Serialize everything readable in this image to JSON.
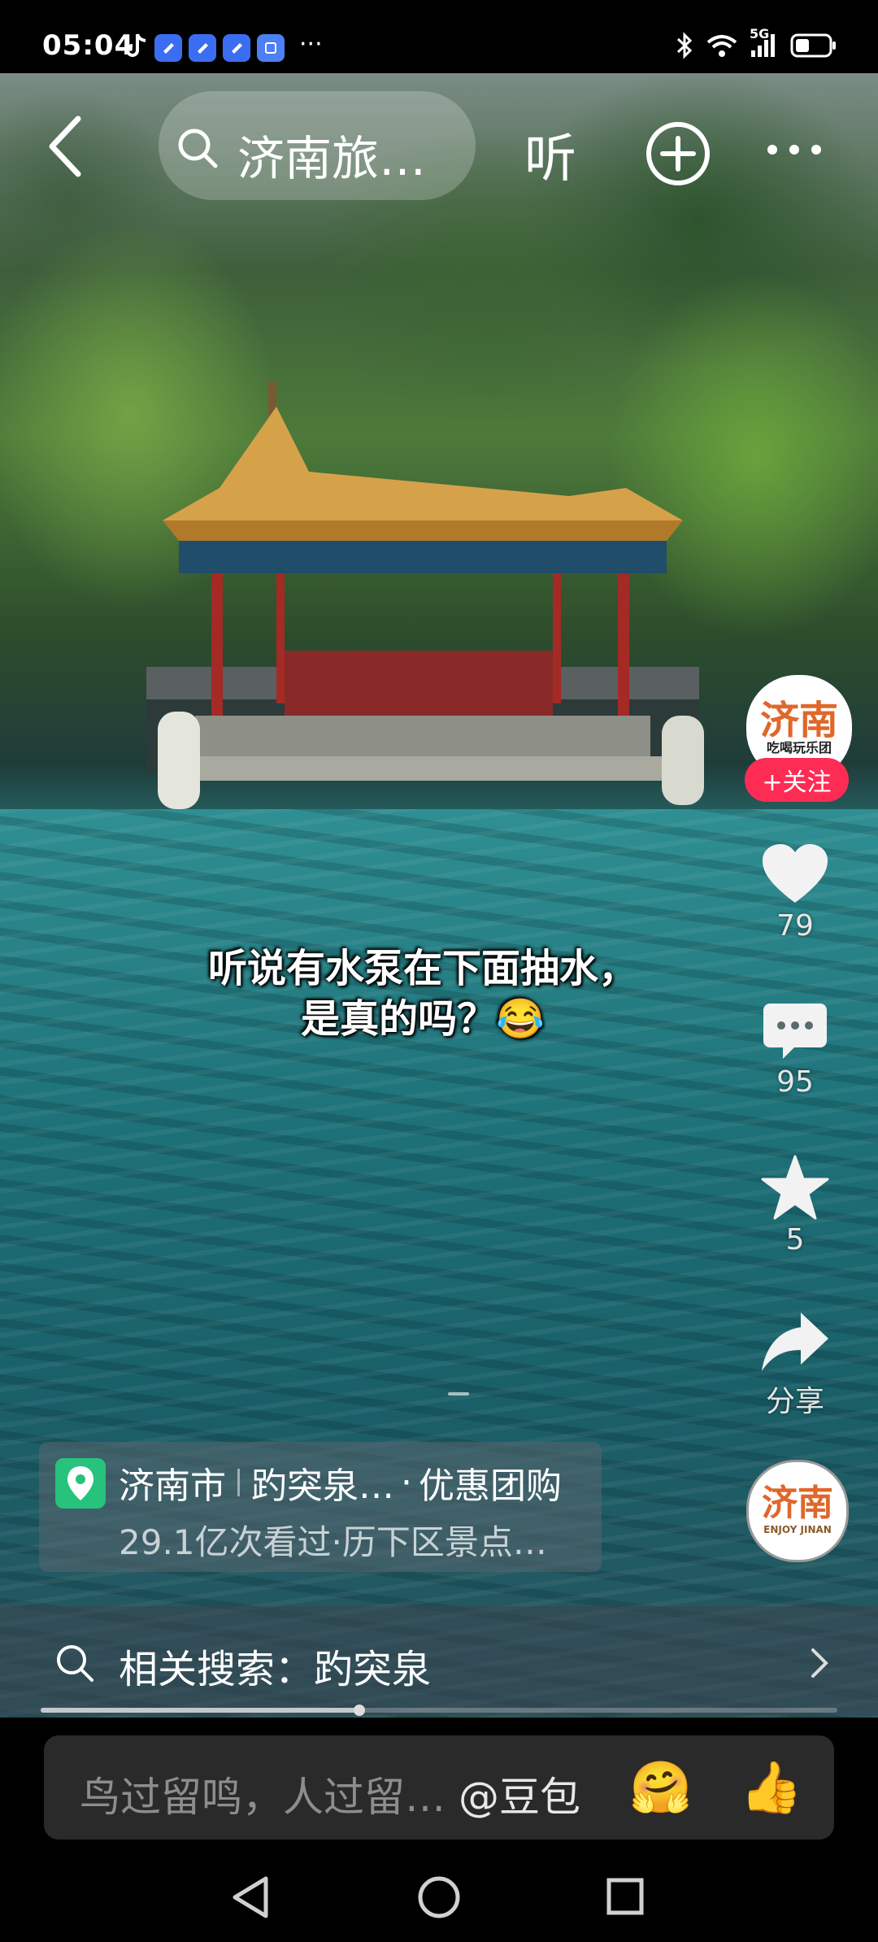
{
  "status_bar": {
    "time": "05:04",
    "more": "···",
    "network": "5G",
    "icons": [
      "tiktok-icon",
      "app-icon",
      "app-icon",
      "app-icon",
      "app-icon",
      "bluetooth-icon",
      "wifi-icon",
      "signal-icon",
      "battery-icon"
    ]
  },
  "top_nav": {
    "search_text": "济南旅…",
    "listen_label": "听"
  },
  "caption": {
    "line1": "听说有水泵在下面抽水，",
    "line2": "是真的吗？😂"
  },
  "author": {
    "avatar_name": "济南",
    "avatar_sub": "吃喝玩乐团",
    "follow_label": "+关注"
  },
  "actions": {
    "like_count": "79",
    "comment_count": "95",
    "favorite_count": "5",
    "share_label": "分享"
  },
  "music_disc": {
    "name": "济南",
    "sub": "ENJOY JINAN"
  },
  "location": {
    "city": "济南市",
    "place": "趵突泉…",
    "deal": "优惠团购",
    "dot": "·",
    "stats": "29.1亿次看过·历下区景点…"
  },
  "related_search": {
    "label": "相关搜索：趵突泉"
  },
  "playback": {
    "progress": 0.4
  },
  "comment_bar": {
    "placeholder": "鸟过留鸣，人过留…",
    "mention": "@豆包",
    "emoji1": "🤗",
    "emoji2": "👍"
  },
  "colors": {
    "follow": "#fe2c55",
    "pin": "#27c27b",
    "water": "#1e7178"
  }
}
